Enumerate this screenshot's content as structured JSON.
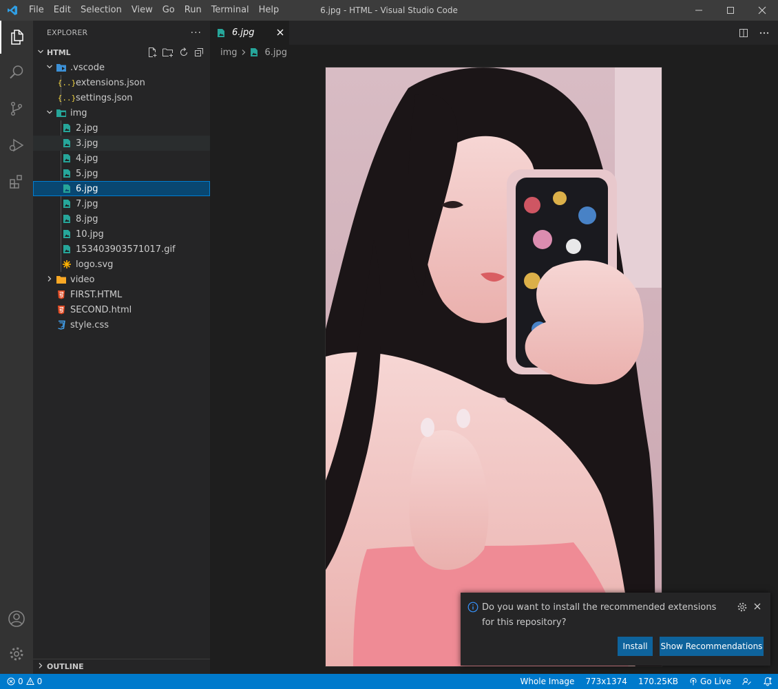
{
  "window": {
    "title": "6.jpg - HTML - Visual Studio Code",
    "menu": [
      "File",
      "Edit",
      "Selection",
      "View",
      "Go",
      "Run",
      "Terminal",
      "Help"
    ]
  },
  "sidebar": {
    "header": "EXPLORER",
    "more": "···",
    "section_title": "HTML",
    "outline_title": "OUTLINE",
    "tree": [
      {
        "label": ".vscode",
        "type": "folder-vscode",
        "depth": 1,
        "expanded": true
      },
      {
        "label": "extensions.json",
        "type": "json",
        "depth": 2
      },
      {
        "label": "settings.json",
        "type": "json",
        "depth": 2
      },
      {
        "label": "img",
        "type": "folder-img",
        "depth": 1,
        "expanded": true
      },
      {
        "label": "2.jpg",
        "type": "image",
        "depth": 2
      },
      {
        "label": "3.jpg",
        "type": "image",
        "depth": 2,
        "hover": true
      },
      {
        "label": "4.jpg",
        "type": "image",
        "depth": 2
      },
      {
        "label": "5.jpg",
        "type": "image",
        "depth": 2
      },
      {
        "label": "6.jpg",
        "type": "image",
        "depth": 2,
        "selected": true
      },
      {
        "label": "7.jpg",
        "type": "image",
        "depth": 2
      },
      {
        "label": "8.jpg",
        "type": "image",
        "depth": 2
      },
      {
        "label": "10.jpg",
        "type": "image",
        "depth": 2
      },
      {
        "label": "153403903571017.gif",
        "type": "image",
        "depth": 2
      },
      {
        "label": "logo.svg",
        "type": "svg",
        "depth": 2
      },
      {
        "label": "video",
        "type": "folder",
        "depth": 1,
        "expanded": false
      },
      {
        "label": "FIRST.HTML",
        "type": "html",
        "depth": 1
      },
      {
        "label": "SECOND.html",
        "type": "html",
        "depth": 1
      },
      {
        "label": "style.css",
        "type": "css",
        "depth": 1
      }
    ]
  },
  "editor": {
    "tab_label": "6.jpg",
    "breadcrumb": [
      "img",
      "6.jpg"
    ]
  },
  "notification": {
    "message": "Do you want to install the recommended extensions for this repository?",
    "install_label": "Install",
    "recs_label": "Show Recommendations"
  },
  "statusbar": {
    "errors": "0",
    "warnings": "0",
    "zoom": "Whole Image",
    "dimensions": "773x1374",
    "size": "170.25KB",
    "golive": "Go Live"
  },
  "colors": {
    "accent": "#007acc",
    "button": "#0e639c",
    "selection": "#094771",
    "image_icon": "#26a69a",
    "json_icon": "#f5d742",
    "html_icon": "#e44d26",
    "css_icon": "#42a5f5"
  }
}
